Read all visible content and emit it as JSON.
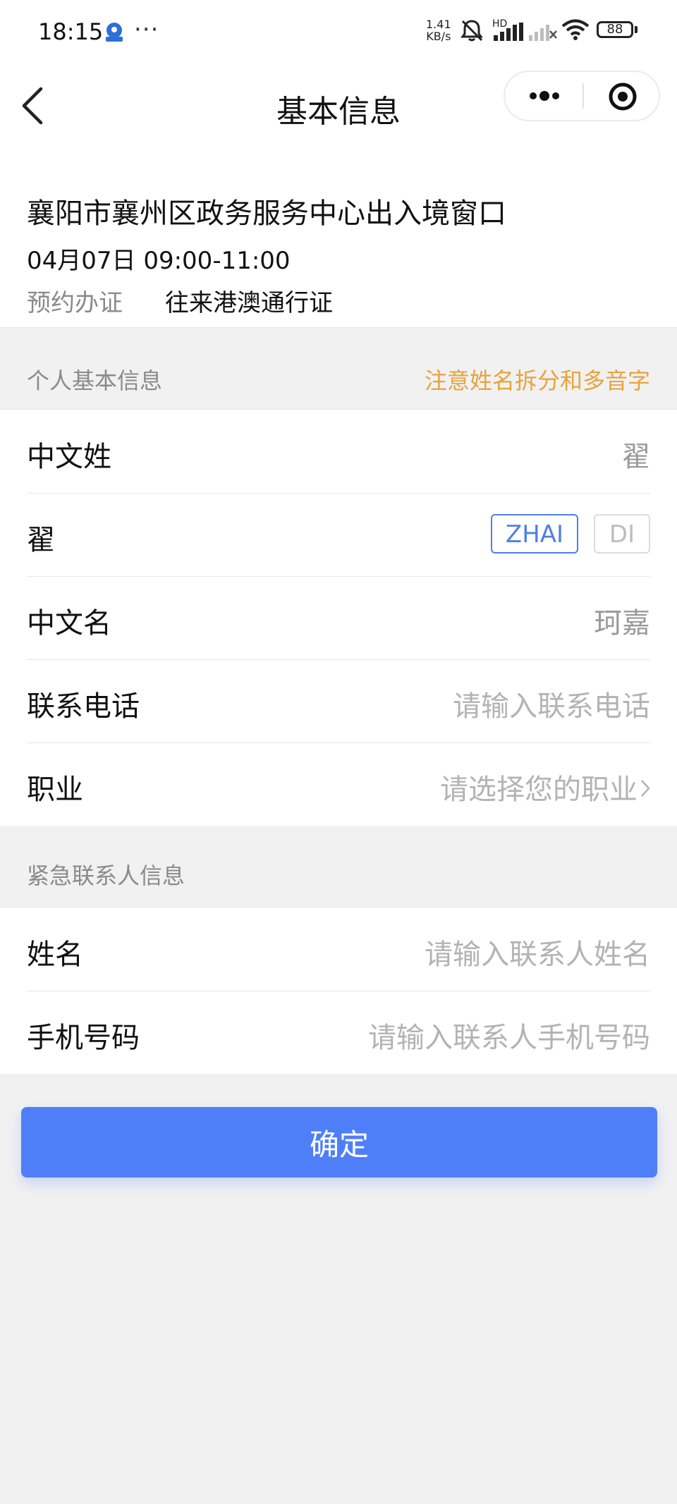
{
  "status_bar": {
    "time": "18:15",
    "dots": "···",
    "net_speed_value": "1.41",
    "net_speed_unit": "KB/s",
    "hd_label": "HD",
    "battery": "88"
  },
  "nav": {
    "title": "基本信息"
  },
  "appointment": {
    "office": "襄阳市襄州区政务服务中心出入境窗口",
    "time": "04月07日 09:00-11:00",
    "type_label": "预约办证",
    "type_value": "往来港澳通行证"
  },
  "personal": {
    "title": "个人基本信息",
    "note": "注意姓名拆分和多音字",
    "surname_label": "中文姓",
    "surname_value": "翟",
    "char_label": "翟",
    "pinyin_options": [
      "ZHAI",
      "DI"
    ],
    "pinyin_selected": "ZHAI",
    "given_label": "中文名",
    "given_value": "珂嘉",
    "phone_label": "联系电话",
    "phone_placeholder": "请输入联系电话",
    "job_label": "职业",
    "job_placeholder": "请选择您的职业"
  },
  "emergency": {
    "title": "紧急联系人信息",
    "name_label": "姓名",
    "name_placeholder": "请输入联系人姓名",
    "mobile_label": "手机号码",
    "mobile_placeholder": "请输入联系人手机号码"
  },
  "confirm_label": "确定",
  "colors": {
    "accent_blue": "#4f7ff8",
    "note_orange": "#e8a33d",
    "background": "#f1f1f2"
  }
}
